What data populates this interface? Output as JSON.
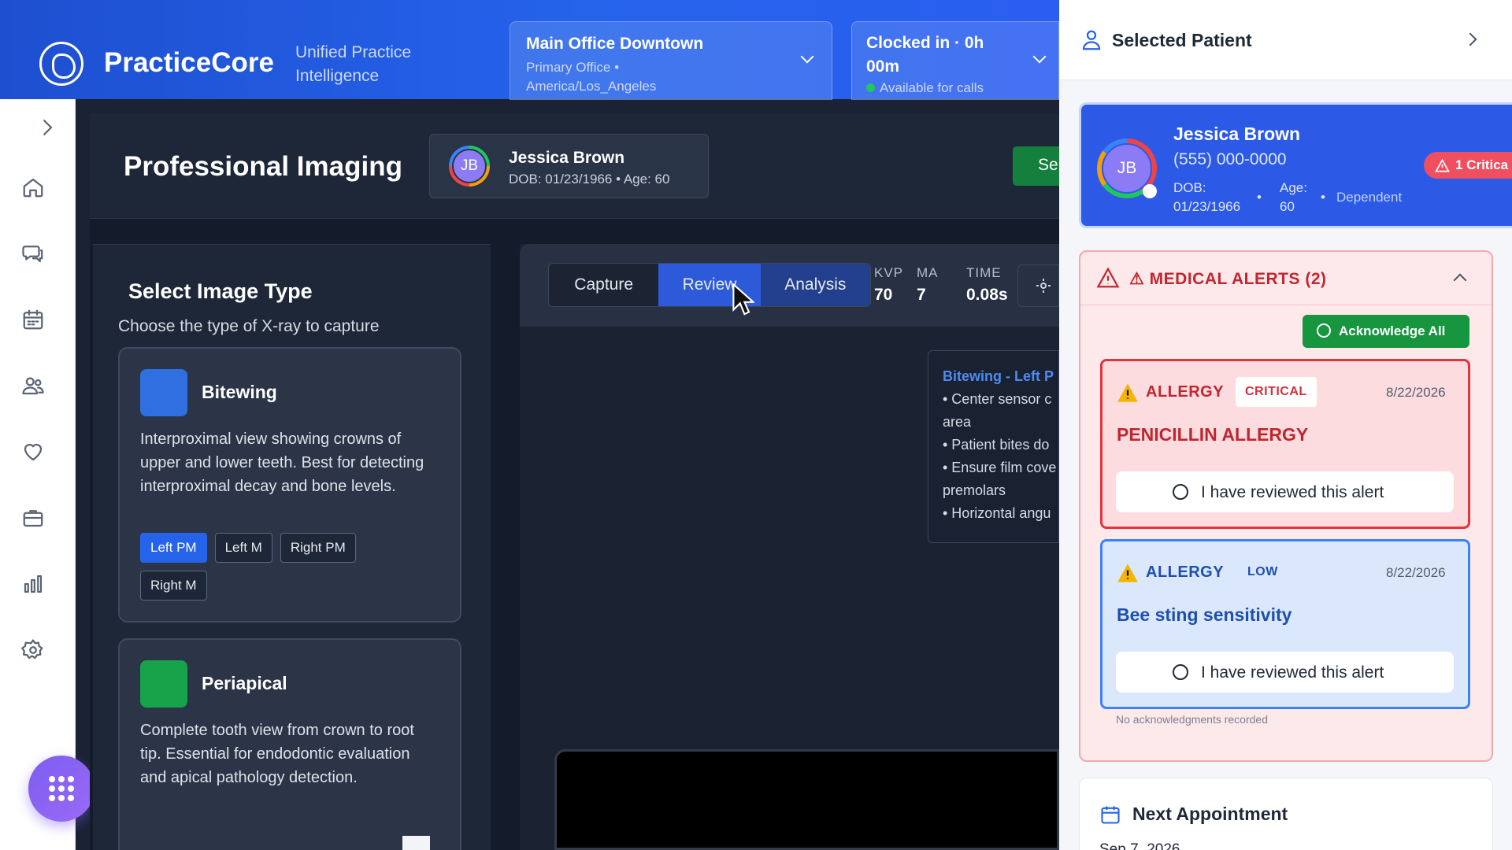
{
  "header": {
    "brand": "PracticeCore",
    "tagline": "Unified Practice Intelligence",
    "office": {
      "name": "Main Office Downtown",
      "detail": "Primary Office • America/Los_Angeles"
    },
    "clock": {
      "status": "Clocked in · 0h 00m",
      "availability": "Available for calls"
    }
  },
  "main": {
    "title": "Professional Imaging",
    "patient": {
      "initials": "JB",
      "name": "Jessica Brown",
      "meta": "DOB: 01/23/1966 • Age: 60"
    },
    "action_label": "Se"
  },
  "image_type": {
    "title": "Select Image Type",
    "subtitle": "Choose the type of X-ray to capture",
    "cards": [
      {
        "name": "Bitewing",
        "color": "#2f6fe0",
        "desc": "Interproximal view showing crowns of upper and lower teeth. Best for detecting interproximal decay and bone levels.",
        "tags": [
          "Left PM",
          "Left M",
          "Right PM",
          "Right M"
        ],
        "selected": "Left PM"
      },
      {
        "name": "Periapical",
        "color": "#16a34a",
        "desc": "Complete tooth view from crown to root tip. Essential for endodontic evaluation and apical pathology detection."
      }
    ]
  },
  "viewer": {
    "tabs": [
      {
        "label": "Capture"
      },
      {
        "label": "Review"
      },
      {
        "label": "Analysis"
      }
    ],
    "active_tab": "Review",
    "params": [
      {
        "label": "KVP",
        "value": "70"
      },
      {
        "label": "MA",
        "value": "7"
      },
      {
        "label": "TIME",
        "value": "0.08s"
      }
    ],
    "tip": {
      "heading": "Bitewing - Left P",
      "lines": [
        "• Center sensor c",
        "area",
        "• Patient bites do",
        "• Ensure film cove",
        "premolars",
        "• Horizontal angu"
      ]
    }
  },
  "selected_patient": {
    "title": "Selected Patient",
    "initials": "JB",
    "name": "Jessica Brown",
    "phone": "(555) 000-0000",
    "dob": "DOB: 01/23/1966",
    "age": "Age: 60",
    "relation": "Dependent",
    "critical_badge": "1 Critica",
    "alerts": {
      "title": "⚠ MEDICAL ALERTS (2)",
      "ack_all": "Acknowledge All",
      "items": [
        {
          "kind": "ALLERGY",
          "severity": "CRITICAL",
          "date": "8/22/2026",
          "name": "PENICILLIN ALLERGY",
          "review": "I have reviewed this alert"
        },
        {
          "kind": "ALLERGY",
          "severity": "LOW",
          "date": "8/22/2026",
          "name": "Bee sting sensitivity",
          "review": "I have reviewed this alert"
        }
      ],
      "footer": "No acknowledgments recorded"
    },
    "appointment": {
      "title": "Next Appointment",
      "date": "Sep 7, 2026"
    }
  },
  "colors": {
    "primary": "#2563eb",
    "critical": "#e3343e",
    "success": "#17953f",
    "sidebar_bg": "#ffffff"
  }
}
